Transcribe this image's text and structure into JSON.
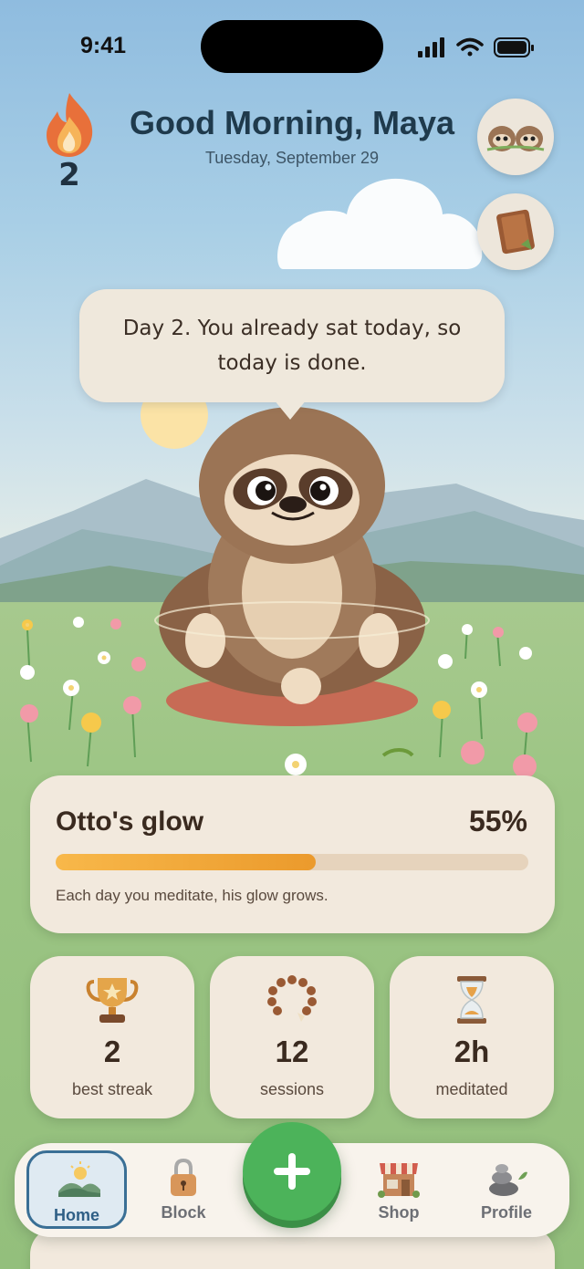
{
  "status_bar": {
    "time": "9:41"
  },
  "header": {
    "streak_count": "2",
    "greeting": "Good Morning, Maya",
    "date": "Tuesday, September 29"
  },
  "speech_bubble": {
    "text": "Day 2. You already sat today, so today is done."
  },
  "glow": {
    "title": "Otto's glow",
    "percent_label": "55%",
    "progress": 0.55,
    "caption": "Each day you meditate, his glow grows."
  },
  "stats": [
    {
      "icon": "trophy-icon",
      "value": "2",
      "label": "best streak"
    },
    {
      "icon": "prayer-beads-icon",
      "value": "12",
      "label": "sessions"
    },
    {
      "icon": "hourglass-icon",
      "value": "2h",
      "label": "meditated"
    }
  ],
  "tabs": [
    {
      "label": "Home",
      "icon": "home-landscape-icon",
      "active": true
    },
    {
      "label": "Block",
      "icon": "lock-icon",
      "active": false
    },
    {
      "label": "Shop",
      "icon": "shop-icon",
      "active": false
    },
    {
      "label": "Profile",
      "icon": "stones-icon",
      "active": false
    }
  ],
  "colors": {
    "accent_green": "#4cb35a",
    "progress_orange": "#eb9a2c",
    "active_tab_border": "#3a6f95",
    "card_bg": "#f2e9dd"
  }
}
